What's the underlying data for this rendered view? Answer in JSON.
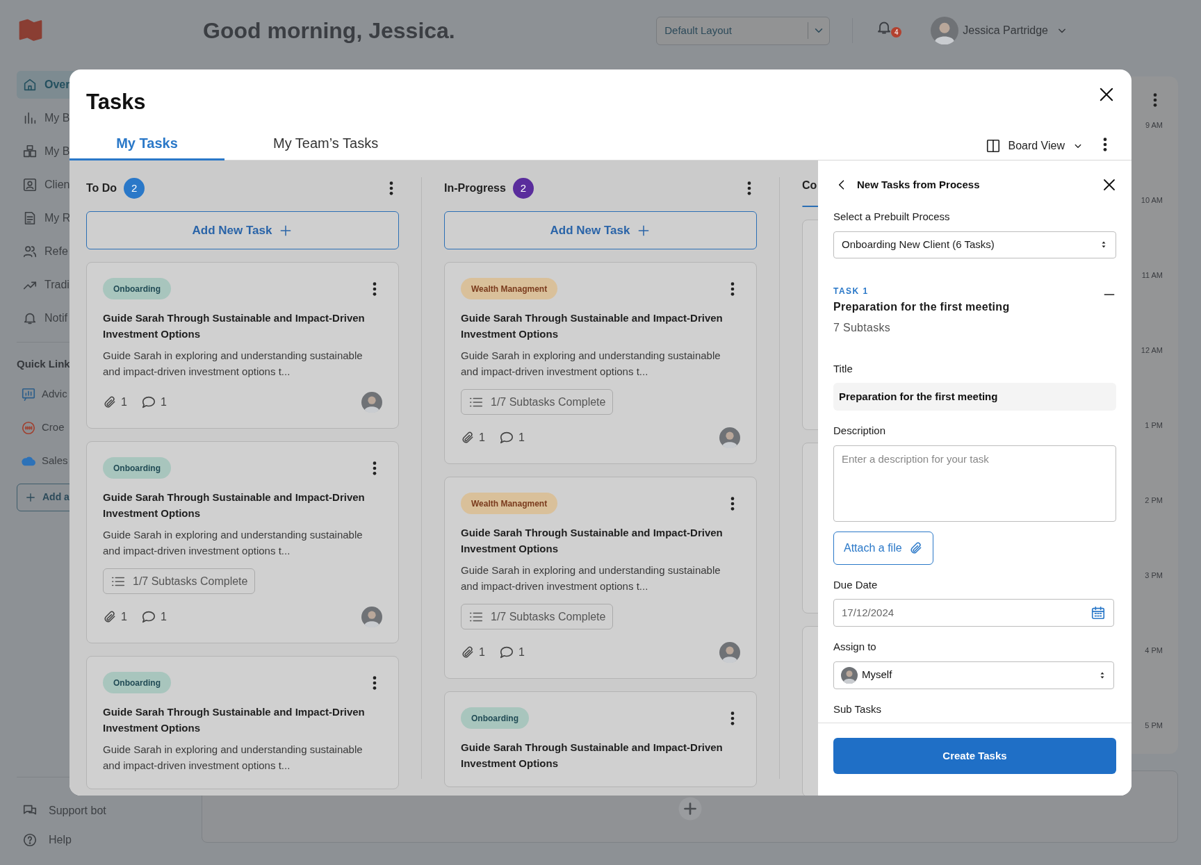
{
  "header": {
    "greeting": "Good morning, Jessica.",
    "layout_select": "Default Layout",
    "notification_count": "4",
    "user_name": "Jessica Partridge"
  },
  "sidebar": {
    "items": [
      {
        "label": "Over",
        "selected": true
      },
      {
        "label": "My B",
        "selected": false
      },
      {
        "label": "My B",
        "selected": false
      },
      {
        "label": "Clien",
        "selected": false
      },
      {
        "label": "My R",
        "selected": false
      },
      {
        "label": "Refe",
        "selected": false
      },
      {
        "label": "Tradi",
        "selected": false
      },
      {
        "label": "Notif",
        "selected": false
      }
    ],
    "quick_links_heading": "Quick Link",
    "quick_links": [
      {
        "label": "Advic"
      },
      {
        "label": "Croe"
      },
      {
        "label": "Sales"
      }
    ],
    "add_link": "Add a",
    "footer": [
      {
        "label": "Support bot"
      },
      {
        "label": "Help"
      }
    ]
  },
  "calendar": {
    "times": [
      "9 AM",
      "10 AM",
      "11 AM",
      "12 AM",
      "1 PM",
      "2 PM",
      "3 PM",
      "4 PM",
      "5 PM"
    ]
  },
  "modal": {
    "title": "Tasks",
    "tabs": [
      {
        "label": "My Tasks",
        "selected": true
      },
      {
        "label": "My Team’s Tasks",
        "selected": false
      }
    ],
    "view": "Board View",
    "columns": [
      {
        "title": "To Do",
        "count": "2",
        "color": "#2a78c8",
        "add_label": "Add New Task",
        "cards": [
          {
            "kind": "onboarding",
            "tag": "Onboarding",
            "title": "Guide Sarah Through Sustainable and Impact-Driven Investment Options",
            "description": "Guide Sarah in exploring and understanding sustainable and impact-driven investment options t...",
            "attachments": "1",
            "comments": "1"
          },
          {
            "kind": "onboarding",
            "tag": "Onboarding",
            "title": "Guide Sarah Through Sustainable and Impact-Driven Investment Options",
            "description": "Guide Sarah in exploring and understanding sustainable and impact-driven investment options t...",
            "subtasks": "1/7 Subtasks Complete",
            "attachments": "1",
            "comments": "1"
          },
          {
            "kind": "onboarding",
            "tag": "Onboarding",
            "title": "Guide Sarah Through Sustainable and Impact-Driven Investment Options",
            "description": "Guide Sarah in exploring and understanding sustainable and impact-driven investment options t..."
          }
        ]
      },
      {
        "title": "In-Progress",
        "count": "2",
        "color": "#5a2d9c",
        "add_label": "Add New Task",
        "cards": [
          {
            "kind": "wealth",
            "tag": "Wealth Managment",
            "title": "Guide Sarah Through Sustainable and Impact-Driven Investment Options",
            "description": "Guide Sarah in exploring and understanding sustainable and impact-driven investment options t...",
            "subtasks": "1/7 Subtasks Complete",
            "attachments": "1",
            "comments": "1"
          },
          {
            "kind": "wealth",
            "tag": "Wealth Managment",
            "title": "Guide Sarah Through Sustainable and Impact-Driven Investment Options",
            "description": "Guide Sarah in exploring and understanding sustainable and impact-driven investment options t...",
            "subtasks": "1/7 Subtasks Complete",
            "attachments": "1",
            "comments": "1"
          },
          {
            "kind": "onboarding",
            "tag": "Onboarding",
            "title": "Guide Sarah Through Sustainable and Impact-Driven Investment Options"
          }
        ]
      },
      {
        "title": "Co",
        "cards": [
          {
            "kind": "cut_off",
            "has_subtasks": true
          },
          {
            "kind": "cut_off",
            "has_subtasks": false
          },
          {
            "kind": "cut_off",
            "has_subtasks": false
          }
        ]
      }
    ],
    "panel": {
      "title": "New Tasks from Process",
      "process_label": "Select a Prebuilt Process",
      "process_value": "Onboarding New Client (6 Tasks)",
      "task_number": "TASK 1",
      "task_title": "Preparation for the first meeting",
      "subtask_count": "7 Subtasks",
      "expanded": true,
      "title_label": "Title",
      "title_value": "Preparation for the first meeting",
      "description_label": "Description",
      "description_placeholder": "Enter a description for your task",
      "attach_label": "Attach a file",
      "due_label": "Due Date",
      "due_value": "17/12/2024",
      "assign_label": "Assign to",
      "assign_value": "Myself",
      "subtasks_label": "Sub Tasks",
      "create_label": "Create Tasks"
    }
  }
}
